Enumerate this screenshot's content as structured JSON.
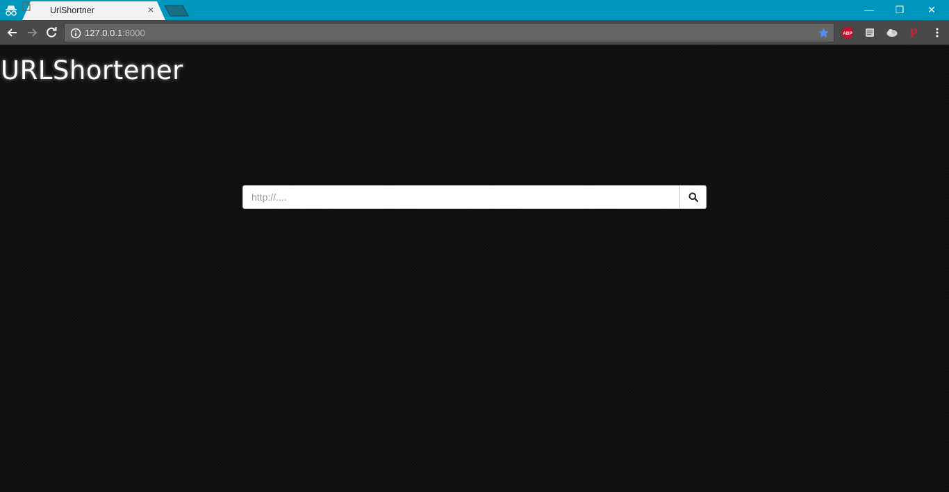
{
  "browser": {
    "tab": {
      "title": "UrlShortner"
    },
    "address": {
      "host": "127.0.0.1",
      "port": ":8000"
    },
    "window_controls": {
      "minimize": "—",
      "restore": "❐",
      "close": "✕"
    },
    "extensions": [
      {
        "icon": "adblock-plus-icon",
        "label": "ABP"
      },
      {
        "icon": "reader-icon"
      },
      {
        "icon": "cloud-icon"
      },
      {
        "icon": "pinterest-icon",
        "label": "P"
      }
    ],
    "colors": {
      "frame": "#0097bf",
      "toolbar": "#494949",
      "omnibox": "#646464",
      "star": "#4d8ff7"
    }
  },
  "page": {
    "brand": "URLShortener",
    "search": {
      "placeholder": "http://...."
    },
    "colors": {
      "background": "#101010",
      "brand_text": "#ffffff"
    }
  }
}
